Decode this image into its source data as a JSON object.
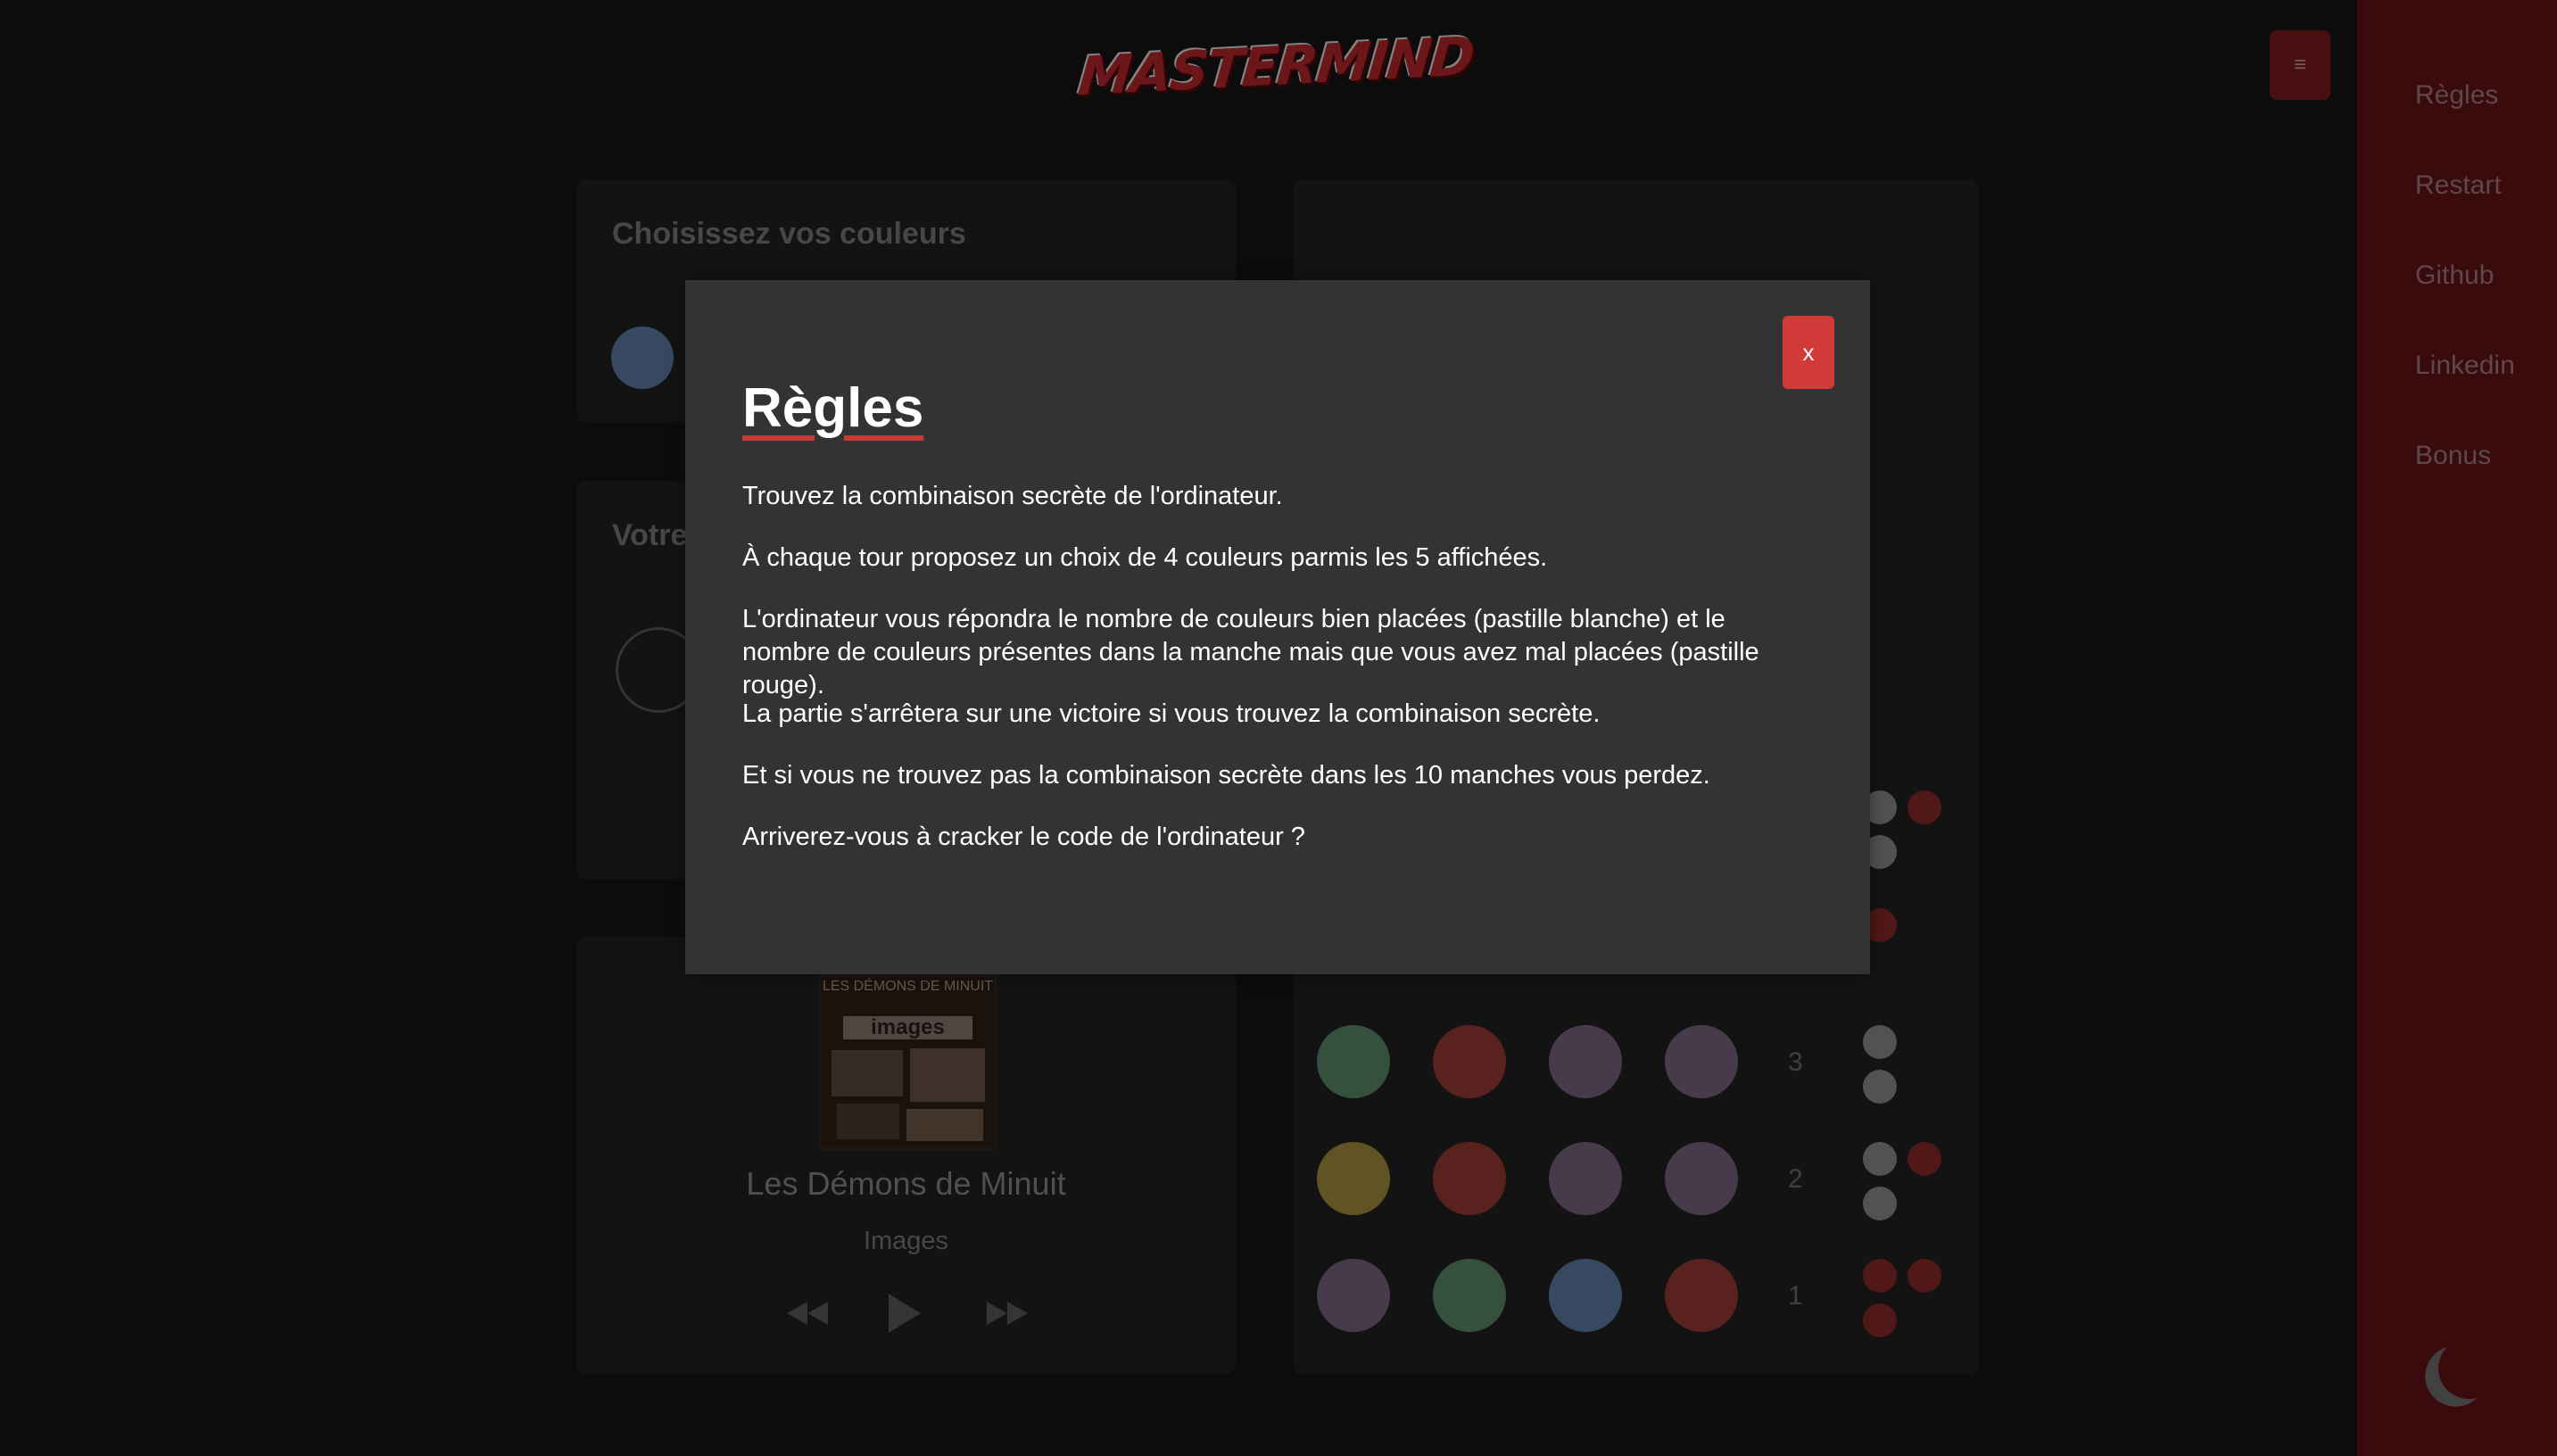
{
  "app": {
    "logo_text": "MASTERMIND"
  },
  "menu": {
    "toggle_icon": "≡"
  },
  "nav": {
    "items": [
      "Règles",
      "Restart",
      "Github",
      "Linkedin",
      "Bonus"
    ],
    "theme_icon": "moon-icon"
  },
  "colors_card": {
    "title": "Choisissez vos couleurs"
  },
  "combo_card": {
    "title": "Votre"
  },
  "board": {
    "visible_rows": [
      {
        "number": "3",
        "pegs": [
          "#5c8a68",
          "#9a3b35",
          "#7a6480",
          "#7a6480"
        ],
        "pins": [
          "white",
          "white"
        ]
      },
      {
        "number": "2",
        "pegs": [
          "#a8913e",
          "#9a3b35",
          "#7a6480",
          "#7a6480"
        ],
        "pins": [
          "white",
          "red",
          "white"
        ]
      },
      {
        "number": "1",
        "pegs": [
          "#7a6480",
          "#5c8a68",
          "#5f7fa6",
          "#9a3b35"
        ],
        "pins": [
          "red",
          "red",
          "red"
        ]
      }
    ]
  },
  "player": {
    "cover_title": "LES DÉMONS DE MINUIT",
    "cover_subtitle": "images",
    "artist": "Les Démons de Minuit",
    "track": "Images",
    "prev_icon": "rewind-icon",
    "play_icon": "play-icon",
    "next_icon": "fast-forward-icon"
  },
  "modal": {
    "close_label": "x",
    "title": "Règles",
    "rules": [
      "Trouvez la combinaison secrète de l'ordinateur.",
      "À chaque tour proposez un choix de 4 couleurs parmis les 5 affichées.",
      "L'ordinateur vous répondra le nombre de couleurs bien placées (pastille blanche) et le nombre de couleurs présentes dans la manche mais que vous avez mal placées (pastille rouge).",
      "La partie s'arrêtera sur une victoire si vous trouvez la combinaison secrète.",
      "Et si vous ne trouvez pas la combinaison secrète dans les 10 manches vous perdez.",
      "Arriverez-vous à cracker le code de l'ordinateur ?"
    ]
  },
  "colors": {
    "accent": "#c8372f",
    "nav_bg": "#641316",
    "modal_bg": "#333333"
  }
}
